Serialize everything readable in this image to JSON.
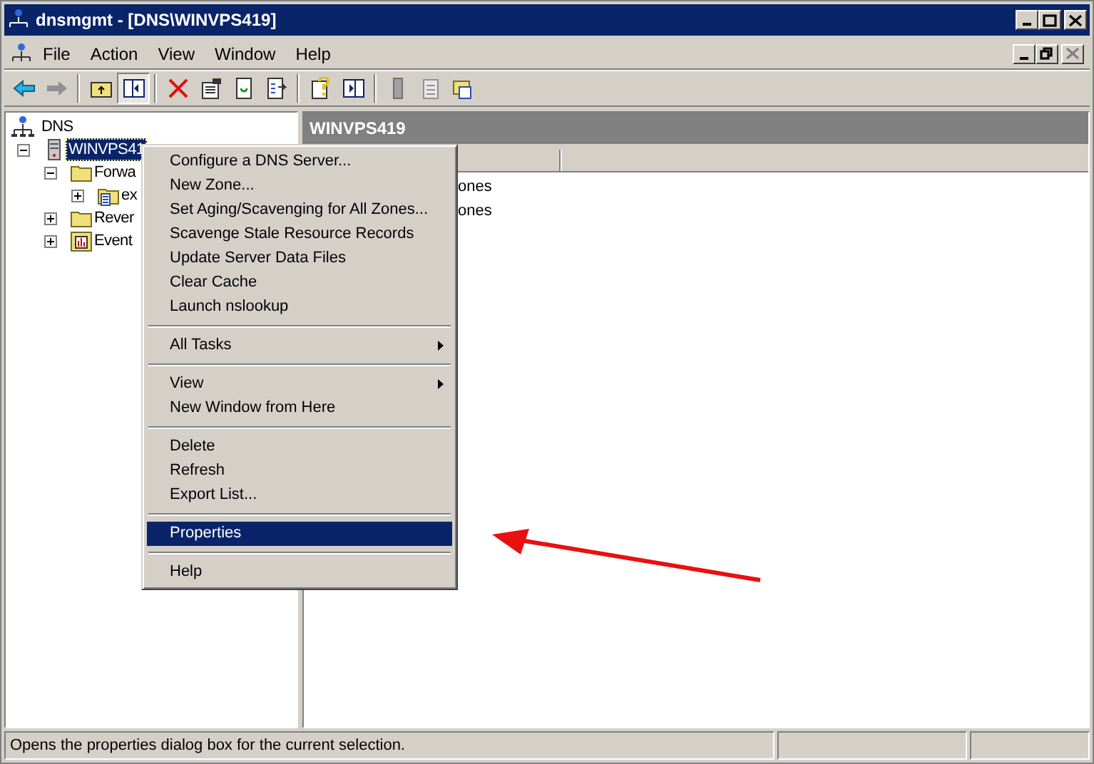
{
  "window": {
    "title": "dnsmgmt - [DNS\\WINVPS419]"
  },
  "menubar": [
    "File",
    "Action",
    "View",
    "Window",
    "Help"
  ],
  "tree": [
    {
      "label": "DNS",
      "kind": "root",
      "children": [
        {
          "label": "WINVPS41",
          "kind": "server",
          "selected": true,
          "expanded": true,
          "children": [
            {
              "label": "Forwa",
              "kind": "folder",
              "selected": false,
              "expanded": true,
              "children": [
                {
                  "label": "ex",
                  "kind": "zone",
                  "selected": false,
                  "expanded": false
                }
              ]
            },
            {
              "label": "Rever",
              "kind": "folder",
              "selected": false,
              "expanded": false
            },
            {
              "label": "Event",
              "kind": "log",
              "selected": false,
              "expanded": false
            }
          ]
        }
      ]
    }
  ],
  "details": {
    "title": "WINVPS419",
    "rows": [
      "ones",
      "ones"
    ]
  },
  "context_menu": [
    {
      "kind": "item",
      "label": "Configure a DNS Server...",
      "submenu": false,
      "selected": false
    },
    {
      "kind": "item",
      "label": "New Zone...",
      "submenu": false,
      "selected": false
    },
    {
      "kind": "item",
      "label": "Set Aging/Scavenging for All Zones...",
      "submenu": false,
      "selected": false
    },
    {
      "kind": "item",
      "label": "Scavenge Stale Resource Records",
      "submenu": false,
      "selected": false
    },
    {
      "kind": "item",
      "label": "Update Server Data Files",
      "submenu": false,
      "selected": false
    },
    {
      "kind": "item",
      "label": "Clear Cache",
      "submenu": false,
      "selected": false
    },
    {
      "kind": "item",
      "label": "Launch nslookup",
      "submenu": false,
      "selected": false
    },
    {
      "kind": "separator"
    },
    {
      "kind": "item",
      "label": "All Tasks",
      "submenu": true,
      "selected": false
    },
    {
      "kind": "separator"
    },
    {
      "kind": "item",
      "label": "View",
      "submenu": true,
      "selected": false
    },
    {
      "kind": "item",
      "label": "New Window from Here",
      "submenu": false,
      "selected": false
    },
    {
      "kind": "separator"
    },
    {
      "kind": "item",
      "label": "Delete",
      "submenu": false,
      "selected": false
    },
    {
      "kind": "item",
      "label": "Refresh",
      "submenu": false,
      "selected": false
    },
    {
      "kind": "item",
      "label": "Export List...",
      "submenu": false,
      "selected": false
    },
    {
      "kind": "separator"
    },
    {
      "kind": "item",
      "label": "Properties",
      "submenu": false,
      "selected": true
    },
    {
      "kind": "separator"
    },
    {
      "kind": "item",
      "label": "Help",
      "submenu": false,
      "selected": false
    }
  ],
  "status_bar": {
    "text": "Opens the properties dialog box for the current selection."
  }
}
